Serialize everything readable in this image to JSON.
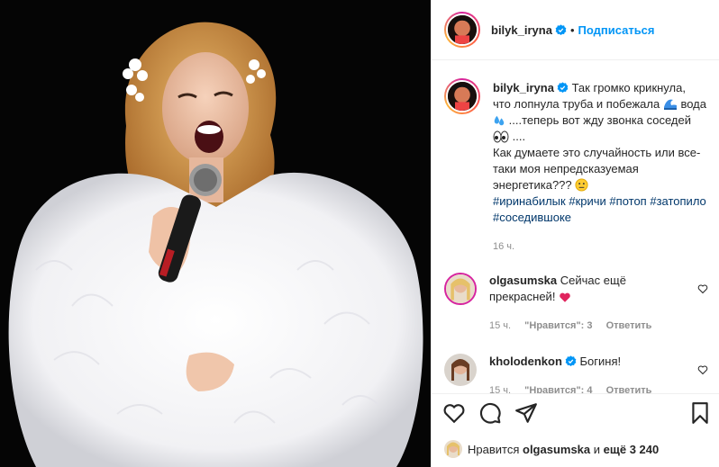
{
  "post": {
    "author": "bilyk_iryna",
    "follow_label": "Подписаться",
    "separator": "•"
  },
  "caption": {
    "author": "bilyk_iryna",
    "line1": "Так громко крикнула, что лопнула труба и побежала",
    "line2a": "вода",
    "line2b": "....теперь вот жду звонка соседей",
    "line2c": "....",
    "line3": "Как думаете это случайность или все-таки моя непредсказуемая энергетика???",
    "hashtags": [
      "#иринабилык",
      "#кричи",
      "#потоп",
      "#затопило",
      "#соседившоке"
    ],
    "time": "16 ч."
  },
  "comments": [
    {
      "author": "olgasumska",
      "text": "Сейчас ещё прекрасней!",
      "time": "15 ч.",
      "likes": "\"Нравится\": 3",
      "reply": "Ответить"
    },
    {
      "author": "kholodenkon",
      "text": "Богиня!",
      "time": "15 ч.",
      "likes": "\"Нравится\": 4",
      "reply": "Ответить"
    }
  ],
  "likes_line": {
    "prefix": "Нравится",
    "user": "olgasumska",
    "middle": "и",
    "rest": "ещё 3 240"
  },
  "icons": [
    "verified-badge-icon",
    "heart-icon",
    "comment-icon",
    "share-icon",
    "save-icon",
    "heart-small-icon"
  ],
  "colors": {
    "link": "#0095f6",
    "hashtag": "#00376b",
    "muted": "#8e8e8e",
    "text": "#262626",
    "heart_red": "#ed4956"
  }
}
